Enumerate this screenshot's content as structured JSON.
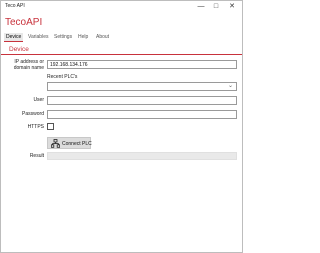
{
  "window": {
    "title": "Teco API"
  },
  "app": {
    "title": "TecoAPI"
  },
  "tabs": [
    {
      "label": "Device",
      "active": true
    },
    {
      "label": "Variables",
      "active": false
    },
    {
      "label": "Settings",
      "active": false
    },
    {
      "label": "Help",
      "active": false
    },
    {
      "label": "About",
      "active": false
    }
  ],
  "section": {
    "title": "Device"
  },
  "form": {
    "ip_label_line1": "IP address or",
    "ip_label_line2": "domain name",
    "ip_value": "192.168.134.176",
    "recent_label": "Recent PLC's",
    "recent_value": "",
    "user_label": "User",
    "user_value": "",
    "password_label": "Password",
    "password_value": "",
    "https_label": "HTTPS",
    "https_checked": false,
    "connect_label": "Connect PLC",
    "result_label": "Result",
    "result_value": ""
  },
  "colors": {
    "accent": "#c8323c",
    "button_bg": "#dcdcdc",
    "readonly_bg": "#e9e9e9"
  },
  "icons": {
    "minimize": "minimize-icon",
    "maximize": "maximize-icon",
    "close": "close-icon",
    "dropdown": "chevron-down-icon",
    "connect": "network-icon"
  }
}
